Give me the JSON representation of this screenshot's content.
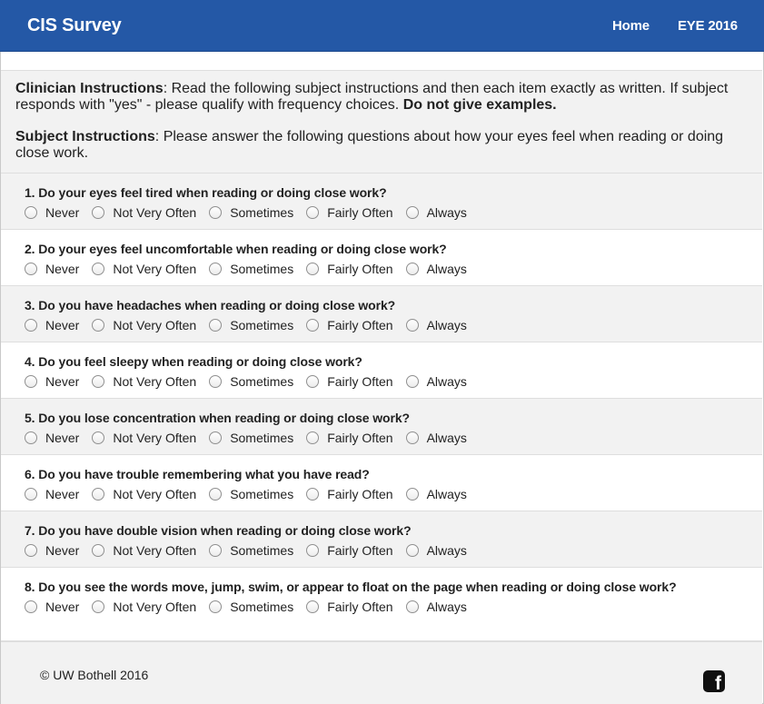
{
  "navbar": {
    "brand": "CIS Survey",
    "links": [
      "Home",
      "EYE 2016"
    ],
    "bg_color": "#2458a6"
  },
  "instructions": {
    "clinician_label": "Clinician Instructions",
    "clinician_text": ": Read the following subject instructions and then each item exactly as written. If subject responds with \"yes\" - please qualify with frequency choices. ",
    "clinician_bold_end": "Do not give examples.",
    "subject_label": "Subject Instructions",
    "subject_text": ": Please answer the following questions about how your eyes feel when reading or doing close work."
  },
  "options": [
    "Never",
    "Not Very Often",
    "Sometimes",
    "Fairly Often",
    "Always"
  ],
  "questions": [
    "1. Do your eyes feel tired when reading or doing close work?",
    "2. Do your eyes feel uncomfortable when reading or doing close work?",
    "3. Do you have headaches when reading or doing close work?",
    "4. Do you feel sleepy when reading or doing close work?",
    "5. Do you lose concentration when reading or doing close work?",
    "6. Do you have trouble remembering what you have read?",
    "7. Do you have double vision when reading or doing close work?",
    "8. Do you see the words move, jump, swim, or appear to float on the page when reading or doing close work?"
  ],
  "footer": {
    "copyright": "© UW Bothell 2016",
    "social_icon": "facebook-icon"
  }
}
